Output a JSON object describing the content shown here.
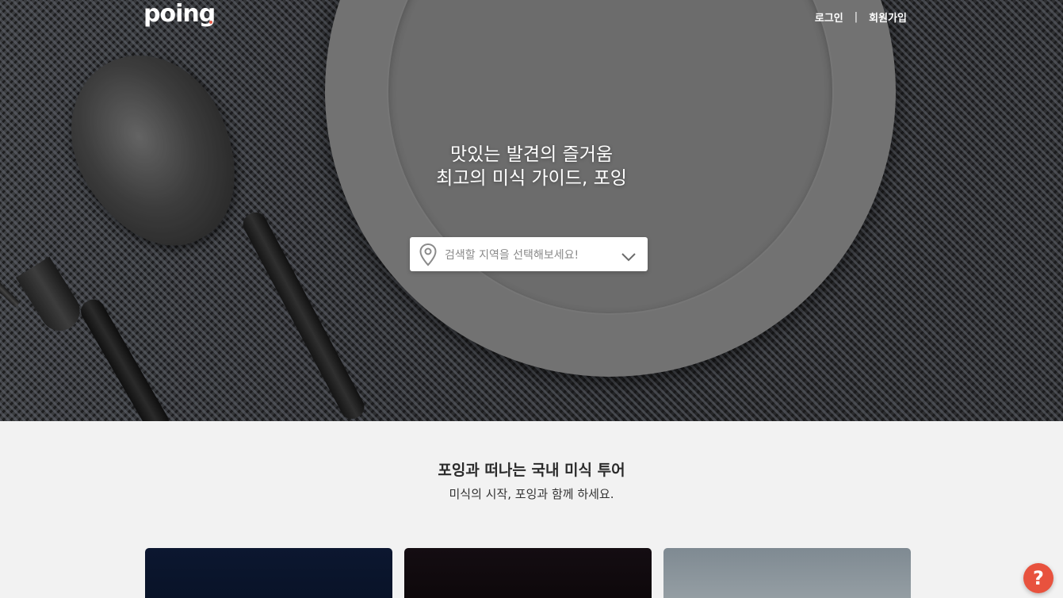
{
  "header": {
    "logo": "poing",
    "nav": {
      "login": "로그인",
      "separator": "|",
      "signup": "회원가입"
    }
  },
  "hero": {
    "title_line1": "맛있는 발견의 즐거움",
    "title_line2": "최고의 미식 가이드, 포잉",
    "region_select": {
      "placeholder": "검색할 지역을 선택해보세요!",
      "icon_left": "location-pin-icon",
      "icon_right": "chevron-down-icon"
    }
  },
  "tour_section": {
    "title": "포잉과 떠나는 국내 미식 투어",
    "subtitle": "미식의 시작, 포잉과 함께 하세요."
  },
  "help": {
    "icon": "question-icon",
    "label": "?"
  },
  "colors": {
    "accent": "#e8523e",
    "section_bg": "#f2f2f2"
  }
}
